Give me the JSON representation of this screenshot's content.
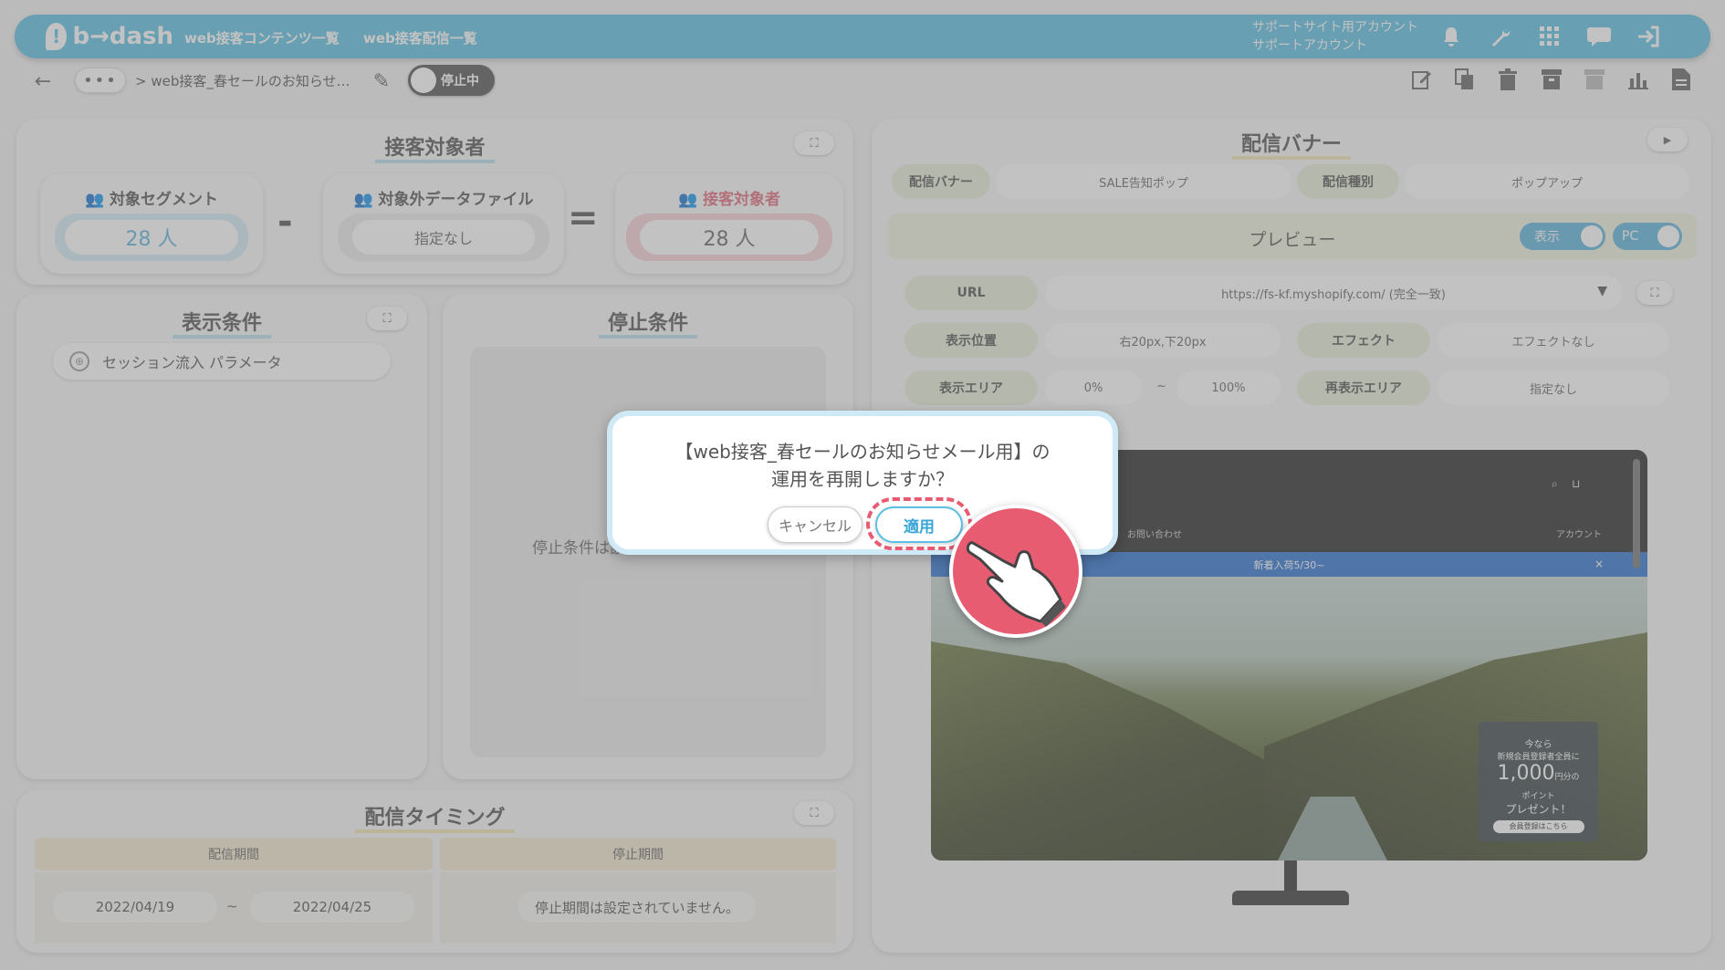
{
  "app": {
    "logo": "b→dash"
  },
  "nav": {
    "contents": "web接客コンテンツ一覧",
    "delivery": "web接客配信一覧"
  },
  "account": {
    "line1": "サポートサイト用アカウント",
    "line2": "サポートアカウント"
  },
  "breadcrumb": {
    "ellipsis": "•••",
    "text": "> web接客_春セールのお知らせ…"
  },
  "status_toggle": {
    "label": "停止中"
  },
  "target": {
    "title": "接客対象者",
    "segment": {
      "label": "対象セグメント",
      "value": "28 人"
    },
    "excluded": {
      "label": "対象外データファイル",
      "value": "指定なし"
    },
    "result": {
      "label": "接客対象者",
      "value": "28 人"
    },
    "minus": "-",
    "equals": "="
  },
  "display_conditions": {
    "title": "表示条件",
    "item": "セッション流入 パラメータ"
  },
  "stop_conditions": {
    "title": "停止条件",
    "empty": "停止条件は設定されていません。"
  },
  "timing": {
    "title": "配信タイミング",
    "period_label": "配信期間",
    "start": "2022/04/19",
    "tilde": "~",
    "end": "2022/04/25",
    "stop_label": "停止期間",
    "stop_value": "停止期間は設定されていません。"
  },
  "banner": {
    "title": "配信バナー",
    "banner_label": "配信バナー",
    "banner_value": "SALE告知ポップ",
    "type_label": "配信種別",
    "type_value": "ポップアップ",
    "preview": "プレビュー",
    "show_toggle": "表示",
    "pc_toggle": "PC",
    "url_label": "URL",
    "url_value": "https://fs-kf.myshopify.com/ (完全一致)",
    "position_label": "表示位置",
    "position_value": "右20px,下20px",
    "effect_label": "エフェクト",
    "effect_value": "エフェクトなし",
    "area_label": "表示エリア",
    "area_from": "0%",
    "area_tilde": "~",
    "area_to": "100%",
    "redisplay_label": "再表示エリア",
    "redisplay_value": "指定なし"
  },
  "preview_site": {
    "nav_contact": "お問い合わせ",
    "nav_account": "アカウント",
    "announcement": "新着入荷5/30~",
    "close": "×",
    "popup": {
      "line1": "今なら",
      "line2": "新規会員登録者全員に",
      "amount": "1,000",
      "unit": "円分の",
      "unit2": "ポイント",
      "line4": "プレゼント！",
      "cta": "会員登録はこちら"
    }
  },
  "dialog": {
    "line1": "【web接客_春セールのお知らせメール用】の",
    "line2": "運用を再開しますか？",
    "cancel": "キャンセル",
    "apply": "適用"
  },
  "colors": {
    "brand": "#5bc0e3",
    "accent_red": "#e85c72"
  }
}
